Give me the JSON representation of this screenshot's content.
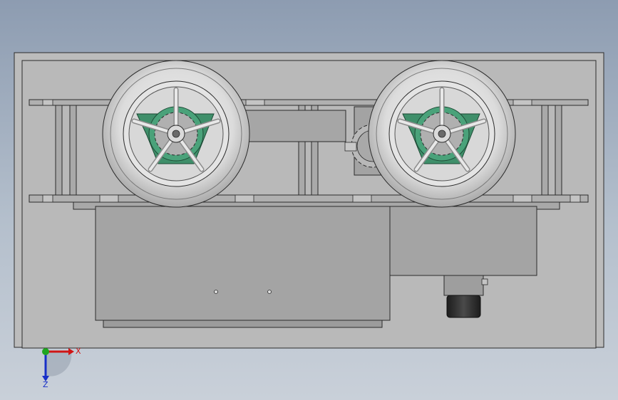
{
  "viewport": {
    "background_top": "#8d9cb1",
    "background_bottom": "#c9d0d9",
    "model_face": "#b9b9b9",
    "model_edge": "#2b2b2b",
    "hub_green": "#3f8f6a"
  },
  "triad": {
    "x_label": "X",
    "z_label": "Z",
    "x_color": "#d01515",
    "y_color": "#1fa51f",
    "z_color": "#1830c8"
  }
}
